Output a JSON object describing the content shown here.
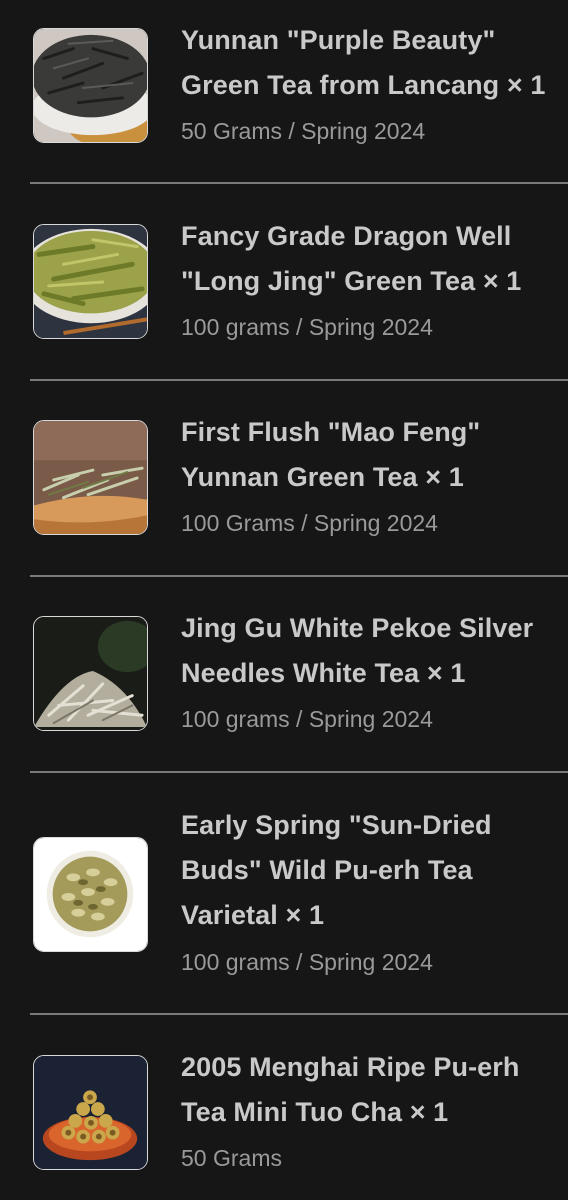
{
  "order": {
    "items": [
      {
        "name": "Yunnan \"Purple Beauty\"\nGreen Tea from Lancang × 1",
        "variant": "50 Grams / Spring 2024"
      },
      {
        "name": "Fancy Grade Dragon Well\n\"Long Jing\" Green Tea × 1",
        "variant": "100 grams / Spring 2024"
      },
      {
        "name": "First Flush \"Mao Feng\"\nYunnan Green Tea × 1",
        "variant": "100 Grams / Spring 2024"
      },
      {
        "name": "Jing Gu White Pekoe Silver\nNeedles White Tea × 1",
        "variant": "100 grams / Spring 2024"
      },
      {
        "name": "Early Spring \"Sun-Dried\nBuds\" Wild Pu-erh Tea\nVarietal × 1",
        "variant": "100 grams / Spring 2024"
      },
      {
        "name": "2005 Menghai Ripe Pu-erh\nTea Mini Tuo Cha × 1",
        "variant": "50 Grams"
      }
    ]
  },
  "colors": {
    "background": "#161616",
    "title_text": "#c9c9c9",
    "variant_text": "#9a9a9a",
    "divider": "#7a7a7a"
  }
}
